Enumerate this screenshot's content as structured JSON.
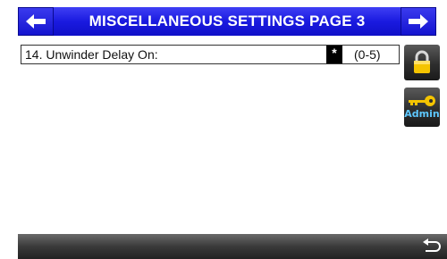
{
  "header": {
    "title": "MISCELLANEOUS SETTINGS PAGE 3",
    "color": "#1a1ae0"
  },
  "settings": [
    {
      "label": "14. Unwinder Delay On:",
      "value": "*",
      "range": "(0-5)"
    }
  ],
  "side_buttons": {
    "lock_icon": "padlock-icon",
    "admin_label": "Admin",
    "admin_icon": "key-icon"
  },
  "icons": {
    "nav_left": "arrow-left-icon",
    "nav_right": "arrow-right-icon",
    "back": "return-arrow-icon"
  },
  "colors": {
    "header_blue": "#1a1ae0",
    "lock_yellow": "#f4c400",
    "admin_text": "#5ec8ff",
    "bar_dark": "#2e2e2e"
  }
}
